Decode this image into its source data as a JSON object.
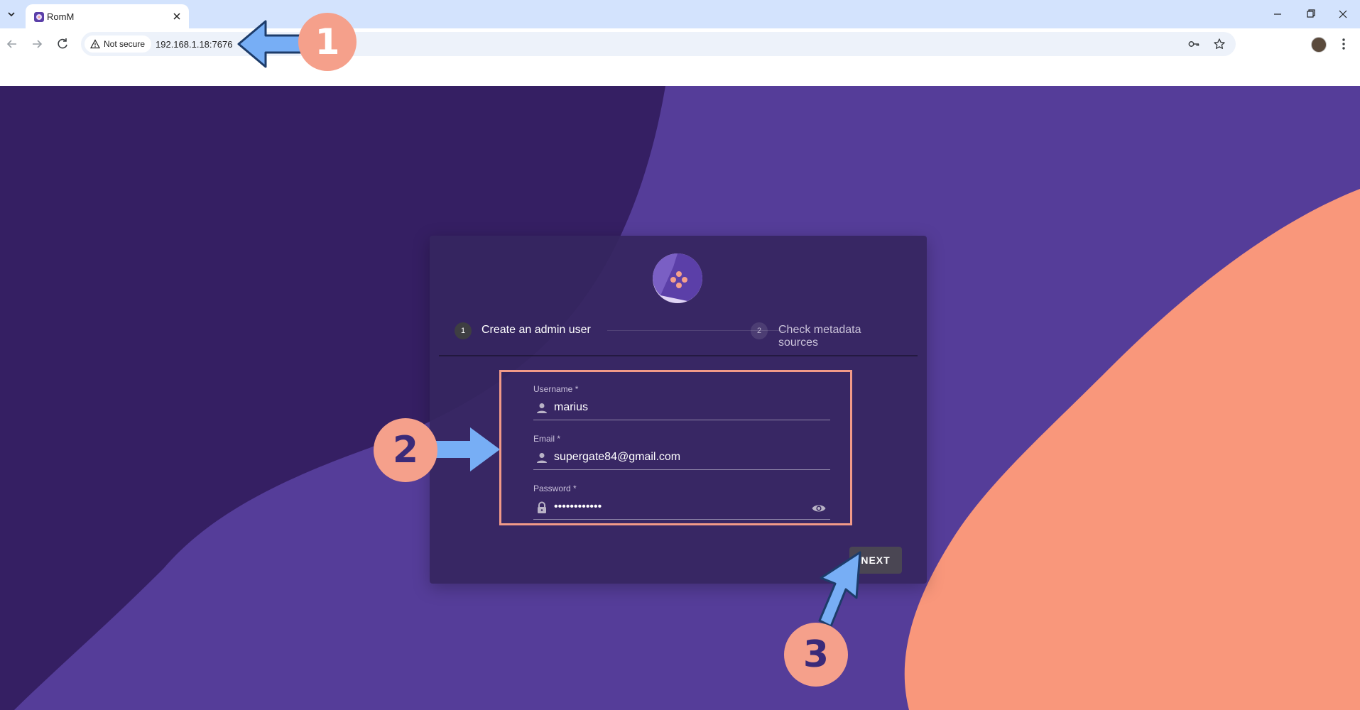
{
  "browser": {
    "tab": {
      "title": "RomM"
    },
    "omnibox": {
      "security_label": "Not secure",
      "url": "192.168.1.18:7676"
    }
  },
  "setup": {
    "steps": [
      {
        "number": "1",
        "label": "Create an admin user"
      },
      {
        "number": "2",
        "label": "Check metadata sources"
      }
    ],
    "fields": {
      "username": {
        "label": "Username *",
        "value": "marius"
      },
      "email": {
        "label": "Email *",
        "value": "supergate84@gmail.com"
      },
      "password": {
        "label": "Password *",
        "value": "••••••••••••"
      }
    },
    "next_label": "NEXT"
  },
  "annotations": {
    "badge_1": "1",
    "badge_2": "2",
    "badge_3": "3"
  },
  "colors": {
    "tabstrip": "#d3e3fd",
    "page_purple": "#553d99",
    "dark_purple": "#351f63",
    "salmon": "#f5a08b",
    "arrow_blue": "#77aef5",
    "card": "#362660"
  },
  "icons": [
    "tab-search-icon",
    "romm-favicon-icon",
    "close-icon",
    "minimize-icon",
    "maximize-icon",
    "back-icon",
    "forward-icon",
    "reload-icon",
    "warning-icon",
    "key-icon",
    "star-icon",
    "avatar",
    "kebab-menu-icon",
    "romm-logo-icon",
    "person-icon",
    "lock-icon",
    "eye-icon",
    "arrow-icon"
  ]
}
